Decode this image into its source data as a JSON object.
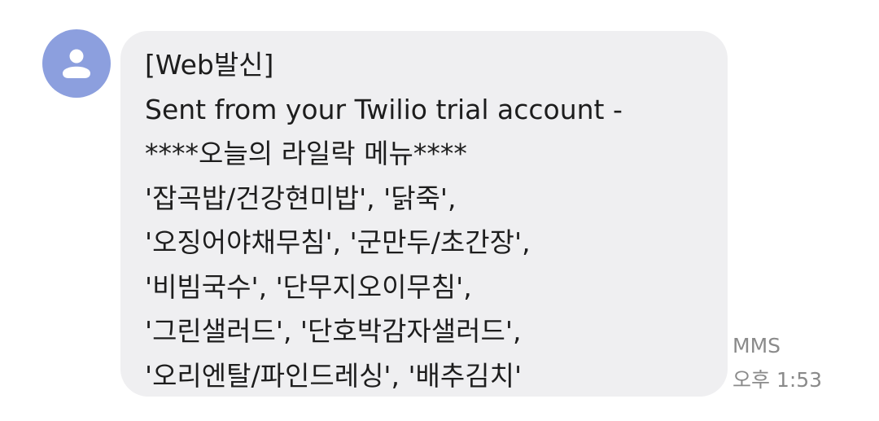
{
  "contact": {
    "avatar_icon": "person-icon",
    "avatar_color": "#8c9fde"
  },
  "message": {
    "lines": [
      "[Web발신]",
      "Sent from your Twilio trial account -",
      "****오늘의 라일락 메뉴****",
      "'잡곡밥/건강현미밥', '닭죽',",
      "'오징어야채무침', '군만두/초간장',",
      "'비빔국수', '단무지오이무침',",
      "'그린샐러드', '단호박감자샐러드',",
      "'오리엔탈/파인드레싱', '배추김치'"
    ],
    "bubble_color": "#efeff1",
    "type_label": "MMS",
    "time": "오후 1:53"
  }
}
